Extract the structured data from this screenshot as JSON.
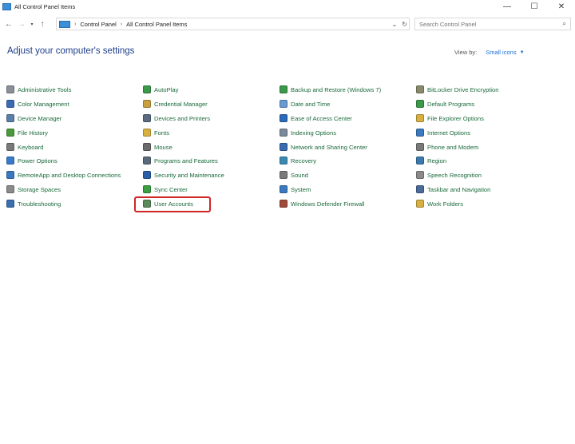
{
  "window": {
    "title": "All Control Panel Items",
    "minimize_glyph": "—",
    "maximize_glyph": "☐",
    "close_glyph": "✕"
  },
  "nav": {
    "back_glyph": "←",
    "forward_glyph": "→",
    "recent_glyph": "▾",
    "up_glyph": "↑",
    "separator": "›",
    "breadcrumb": [
      "Control Panel",
      "All Control Panel Items"
    ],
    "dropdown_glyph": "⌄",
    "refresh_glyph": "↻"
  },
  "search": {
    "placeholder": "Search Control Panel",
    "icon_glyph": "⌕"
  },
  "main": {
    "heading": "Adjust your computer's settings",
    "view_by_label": "View by:",
    "view_by_value": "Small icons",
    "view_by_caret": "▼"
  },
  "columns": [
    {
      "items": [
        {
          "label": "Administrative Tools",
          "icon": "admin-tools-icon",
          "color": "#8a8f99"
        },
        {
          "label": "Color Management",
          "icon": "color-management-icon",
          "color": "#3a6bb5"
        },
        {
          "label": "Device Manager",
          "icon": "device-manager-icon",
          "color": "#5a7fa8"
        },
        {
          "label": "File History",
          "icon": "file-history-icon",
          "color": "#4a9a3a"
        },
        {
          "label": "Keyboard",
          "icon": "keyboard-icon",
          "color": "#7a7a7a"
        },
        {
          "label": "Power Options",
          "icon": "power-options-icon",
          "color": "#3a7ac8"
        },
        {
          "label": "RemoteApp and Desktop Connections",
          "icon": "remoteapp-icon",
          "color": "#3a78c0"
        },
        {
          "label": "Storage Spaces",
          "icon": "storage-spaces-icon",
          "color": "#8a8a8a"
        },
        {
          "label": "Troubleshooting",
          "icon": "troubleshooting-icon",
          "color": "#3a6fb0"
        }
      ]
    },
    {
      "items": [
        {
          "label": "AutoPlay",
          "icon": "autoplay-icon",
          "color": "#3a9a4a"
        },
        {
          "label": "Credential Manager",
          "icon": "credential-manager-icon",
          "color": "#c8a040"
        },
        {
          "label": "Devices and Printers",
          "icon": "devices-printers-icon",
          "color": "#5a6a80"
        },
        {
          "label": "Fonts",
          "icon": "fonts-icon",
          "color": "#d8b040"
        },
        {
          "label": "Mouse",
          "icon": "mouse-icon",
          "color": "#6a6a6a"
        },
        {
          "label": "Programs and Features",
          "icon": "programs-features-icon",
          "color": "#5a6a7a"
        },
        {
          "label": "Security and Maintenance",
          "icon": "security-maintenance-icon",
          "color": "#2a5fa8"
        },
        {
          "label": "Sync Center",
          "icon": "sync-center-icon",
          "color": "#3aa040"
        },
        {
          "label": "User Accounts",
          "icon": "user-accounts-icon",
          "color": "#5a8a5a"
        }
      ]
    },
    {
      "items": [
        {
          "label": "Backup and Restore (Windows 7)",
          "icon": "backup-restore-icon",
          "color": "#3a9a4a"
        },
        {
          "label": "Date and Time",
          "icon": "date-time-icon",
          "color": "#6a9ad0"
        },
        {
          "label": "Ease of Access Center",
          "icon": "ease-of-access-icon",
          "color": "#2a6ab8"
        },
        {
          "label": "Indexing Options",
          "icon": "indexing-options-icon",
          "color": "#7a8a9a"
        },
        {
          "label": "Network and Sharing Center",
          "icon": "network-sharing-icon",
          "color": "#3a6ab0"
        },
        {
          "label": "Recovery",
          "icon": "recovery-icon",
          "color": "#3a8ab0"
        },
        {
          "label": "Sound",
          "icon": "sound-icon",
          "color": "#7a7a7a"
        },
        {
          "label": "System",
          "icon": "system-icon",
          "color": "#3a7ac0"
        },
        {
          "label": "Windows Defender Firewall",
          "icon": "firewall-icon",
          "color": "#a04a3a"
        }
      ]
    },
    {
      "items": [
        {
          "label": "BitLocker Drive Encryption",
          "icon": "bitlocker-icon",
          "color": "#8a8a6a"
        },
        {
          "label": "Default Programs",
          "icon": "default-programs-icon",
          "color": "#3a9a4a"
        },
        {
          "label": "File Explorer Options",
          "icon": "file-explorer-options-icon",
          "color": "#d8b040"
        },
        {
          "label": "Internet Options",
          "icon": "internet-options-icon",
          "color": "#3a7ac0"
        },
        {
          "label": "Phone and Modem",
          "icon": "phone-modem-icon",
          "color": "#7a7a7a"
        },
        {
          "label": "Region",
          "icon": "region-icon",
          "color": "#3a7ab0"
        },
        {
          "label": "Speech Recognition",
          "icon": "speech-recognition-icon",
          "color": "#8a8a8a"
        },
        {
          "label": "Taskbar and Navigation",
          "icon": "taskbar-navigation-icon",
          "color": "#4a6a9a"
        },
        {
          "label": "Work Folders",
          "icon": "work-folders-icon",
          "color": "#d8b040"
        }
      ]
    }
  ]
}
